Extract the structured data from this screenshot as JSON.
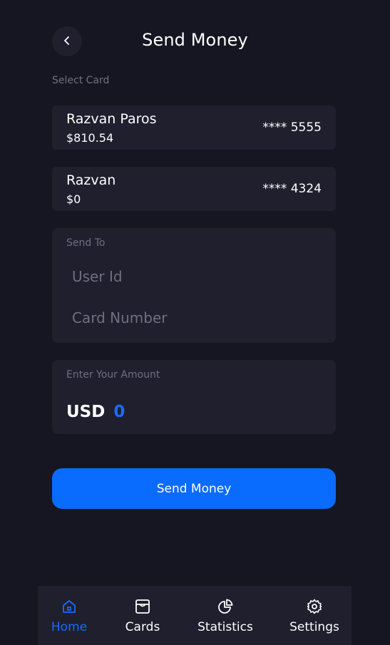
{
  "header": {
    "title": "Send Money",
    "back_icon": "chevron-left-icon"
  },
  "select_card": {
    "label": "Select Card",
    "cards": [
      {
        "name": "Razvan Paros",
        "balance": "$810.54",
        "number": "**** 5555"
      },
      {
        "name": "Razvan",
        "balance": "$0",
        "number": "**** 4324"
      }
    ]
  },
  "send_to": {
    "label": "Send To",
    "user_id_placeholder": "User Id",
    "user_id_value": "",
    "card_number_placeholder": "Card Number",
    "card_number_value": ""
  },
  "amount": {
    "label": "Enter Your Amount",
    "currency": "USD",
    "value": "0"
  },
  "send_button": {
    "label": "Send Money"
  },
  "nav": {
    "items": [
      {
        "label": "Home",
        "icon": "home-icon",
        "active": true
      },
      {
        "label": "Cards",
        "icon": "wallet-icon",
        "active": false
      },
      {
        "label": "Statistics",
        "icon": "pie-chart-icon",
        "active": false
      },
      {
        "label": "Settings",
        "icon": "gear-icon",
        "active": false
      }
    ]
  },
  "colors": {
    "background": "#161622",
    "surface": "#1f1f2e",
    "accent": "#0a6bff",
    "muted_text": "#6f6f80"
  }
}
